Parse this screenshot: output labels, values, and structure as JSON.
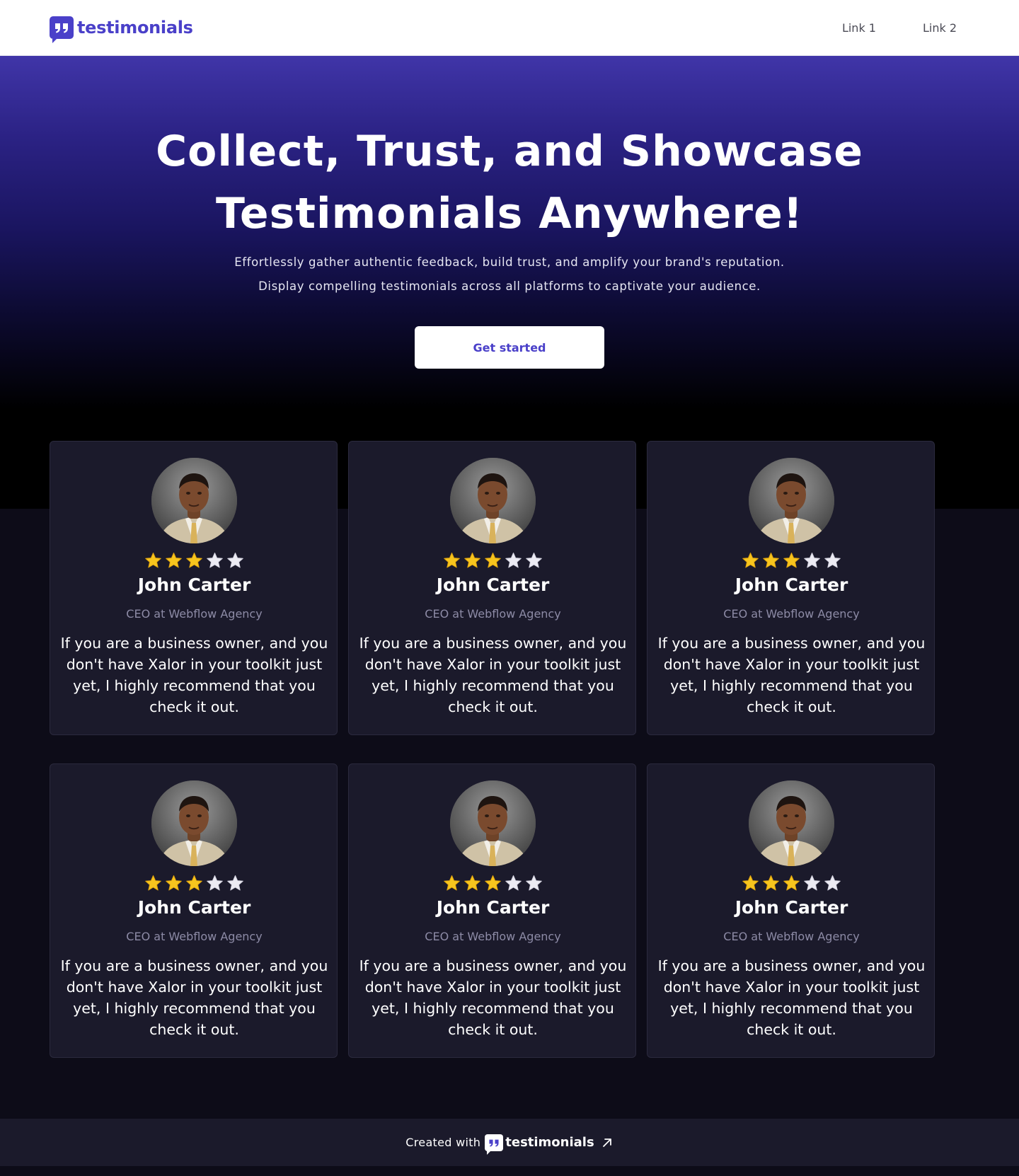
{
  "navbar": {
    "brand": "testimonials",
    "links": [
      {
        "label": "Link 1"
      },
      {
        "label": "Link 2"
      }
    ]
  },
  "hero": {
    "title_line1": "Collect, Trust, and Showcase",
    "title_line2": "Testimonials Anywhere!",
    "subtitle_line1": "Effortlessly gather authentic feedback, build trust, and amplify your brand's reputation.",
    "subtitle_line2": "Display compelling testimonials across all platforms to captivate your audience.",
    "cta_label": "Get started"
  },
  "testimonials": [
    {
      "name": "John Carter",
      "role": "CEO at Webflow Agency",
      "rating": 3,
      "max_rating": 5,
      "quote": "If you are a business owner, and you don't have Xalor in your toolkit just yet, I highly recommend that you check it out."
    },
    {
      "name": "John Carter",
      "role": "CEO at Webflow Agency",
      "rating": 3,
      "max_rating": 5,
      "quote": "If you are a business owner, and you don't have Xalor in your toolkit just yet, I highly recommend that you check it out."
    },
    {
      "name": "John Carter",
      "role": "CEO at Webflow Agency",
      "rating": 3,
      "max_rating": 5,
      "quote": "If you are a business owner, and you don't have Xalor in your toolkit just yet, I highly recommend that you check it out."
    },
    {
      "name": "John Carter",
      "role": "CEO at Webflow Agency",
      "rating": 3,
      "max_rating": 5,
      "quote": "If you are a business owner, and you don't have Xalor in your toolkit just yet, I highly recommend that you check it out."
    },
    {
      "name": "John Carter",
      "role": "CEO at Webflow Agency",
      "rating": 3,
      "max_rating": 5,
      "quote": "If you are a business owner, and you don't have Xalor in your toolkit just yet, I highly recommend that you check it out."
    },
    {
      "name": "John Carter",
      "role": "CEO at Webflow Agency",
      "rating": 3,
      "max_rating": 5,
      "quote": "If you are a business owner, and you don't have Xalor in your toolkit just yet, I highly recommend that you check it out."
    }
  ],
  "footer": {
    "prefix": "Created with",
    "brand": "testimonials",
    "icon": "external-arrow-icon"
  },
  "colors": {
    "brand": "#4a40c9",
    "star_filled": "#f7c51e",
    "star_empty": "#ecebf3",
    "card_bg": "#1b1a2b",
    "page_bg": "#0d0c18"
  }
}
